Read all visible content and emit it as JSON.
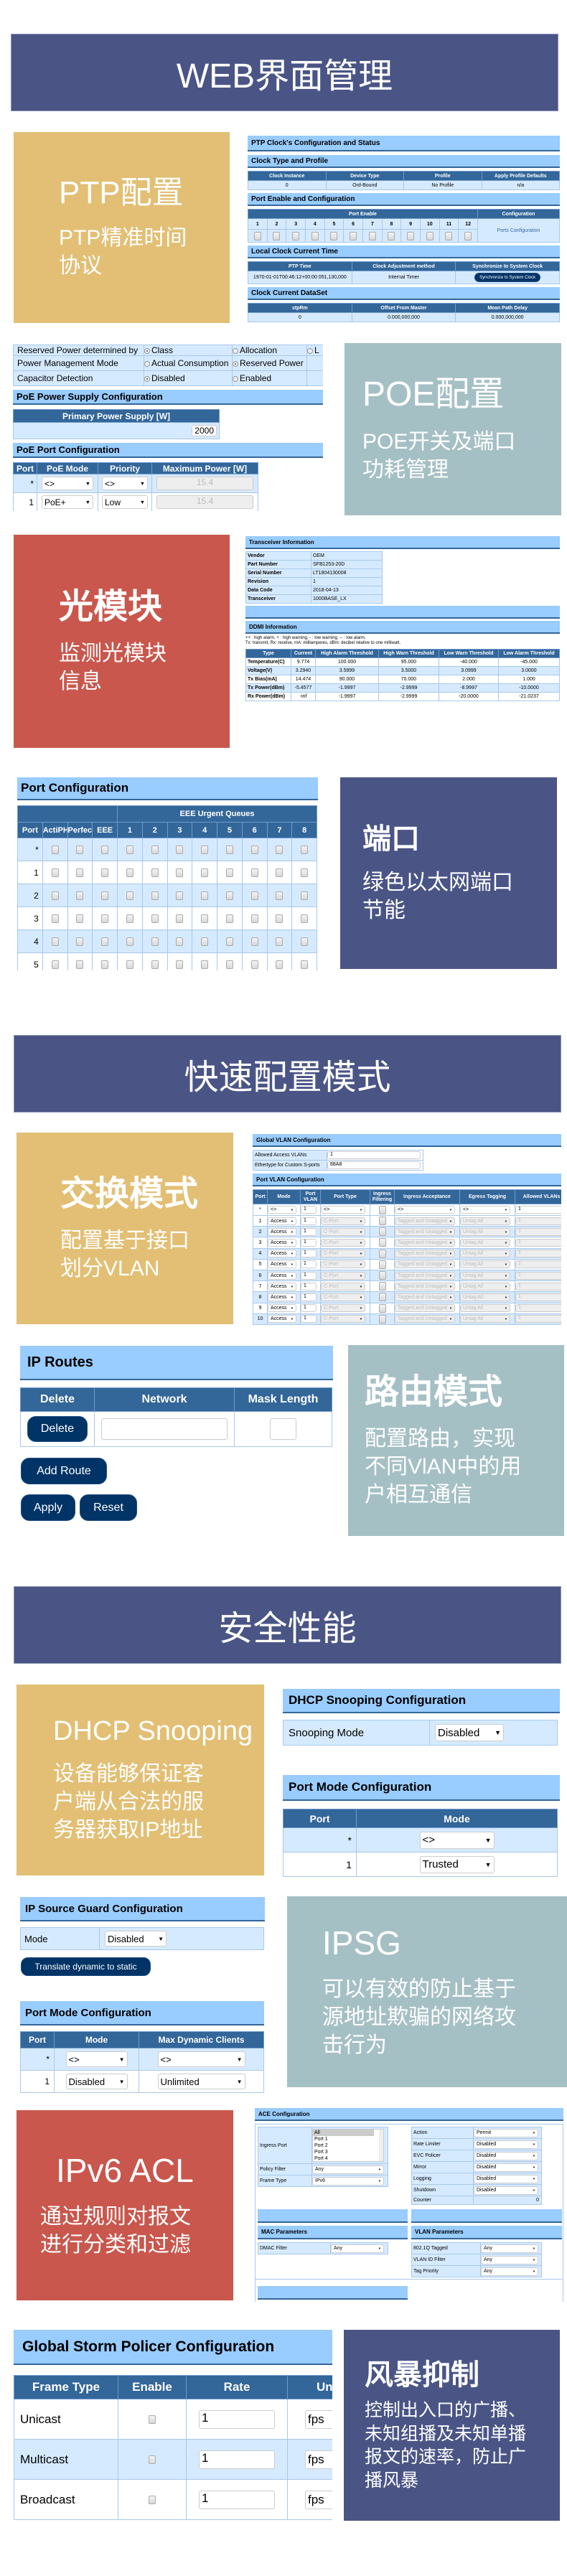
{
  "banners": [
    "WEB界面管理",
    "快速配置模式",
    "安全性能"
  ],
  "colors": {
    "banner": "#4a5586",
    "gold": "#e2bf74",
    "teal": "#a5c0c4",
    "red": "#c9574d",
    "header_bar": "#99ccff",
    "table_header": "#336699",
    "button": "#003366"
  },
  "features": {
    "ptp": {
      "title": "PTP配置",
      "desc": [
        "PTP精准时间",
        "协议"
      ]
    },
    "poe": {
      "title": "POE配置",
      "desc": [
        "POE开关及端口",
        "功耗管理"
      ]
    },
    "sfp": {
      "title": "光模块",
      "desc": [
        "监测光模块",
        "信息"
      ]
    },
    "port": {
      "title": "端口",
      "desc": [
        "绿色以太网端口",
        "节能"
      ]
    },
    "switch": {
      "title": "交换模式",
      "desc": [
        "配置基于接口",
        "划分VLAN"
      ]
    },
    "route": {
      "title": "路由模式",
      "desc": [
        "配置路由，实现",
        "不同VlAN中的用",
        "户相互通信"
      ]
    },
    "dhcp": {
      "title": "DHCP Snooping",
      "desc": [
        "设备能够保证客",
        "户端从合法的服",
        "务器获取IP地址"
      ]
    },
    "ipsg": {
      "title": "IPSG",
      "desc": [
        "可以有效的防止基于",
        "源地址欺骗的网络攻",
        "击行为"
      ]
    },
    "acl": {
      "title": "IPv6 ACL",
      "desc": [
        "通过规则对报文",
        "进行分类和过滤"
      ]
    },
    "storm": {
      "title": "风暴抑制",
      "desc": [
        "控制出入口的广播、",
        "未知组播及未知单播",
        "报文的速率，防止广",
        "播风暴"
      ]
    }
  },
  "screens": {
    "ptp": {
      "title": "PTP Clock's Configuration and Status",
      "clock_type": {
        "title": "Clock Type and Profile",
        "headers": [
          "Clock Instance",
          "Device Type",
          "Profile",
          "Apply Profile Defaults"
        ],
        "row": [
          "0",
          "Ord-Bound",
          "No Profile",
          "n/a"
        ]
      },
      "port_enable": {
        "title": "Port Enable and Configuration",
        "header_enable": "Port Enable",
        "header_config": "Configuration",
        "ports": [
          "1",
          "2",
          "3",
          "4",
          "5",
          "6",
          "7",
          "8",
          "9",
          "10",
          "11",
          "12"
        ],
        "config_link": "Ports Configuration"
      },
      "local_clock": {
        "title": "Local Clock Current Time",
        "headers": [
          "PTP Time",
          "Clock Adjustment method",
          "Synchronize to System Clock"
        ],
        "ptp_time": "1970-01-01T00:46:12+00:00 051,130,000",
        "method": "Internal Timer",
        "sync_button": "Synchronize to System Clock"
      },
      "dataset": {
        "title": "Clock Current DataSet",
        "headers": [
          "stpRm",
          "Offset From Master",
          "Mean Path Delay"
        ],
        "row": [
          "0",
          "0.000,000,000",
          "0.000,000,000"
        ]
      }
    },
    "poe": {
      "settings": [
        {
          "label": "Reserved Power determined by",
          "options": [
            "Class",
            "Allocation",
            "L"
          ],
          "selected": 0
        },
        {
          "label": "Power Management Mode",
          "options": [
            "Actual Consumption",
            "Reserved Power"
          ],
          "selected": 1
        },
        {
          "label": "Capacitor Detection",
          "options": [
            "Disabled",
            "Enabled"
          ],
          "selected": 0
        }
      ],
      "supply_title": "PoE Power Supply Configuration",
      "supply_header": "Primary Power Supply [W]",
      "supply_value": "2000",
      "port_title": "PoE Port Configuration",
      "headers": [
        "Port",
        "PoE Mode",
        "Priority",
        "Maximum Power [W]"
      ],
      "rows": [
        [
          "*",
          "<>",
          "<>",
          "15.4"
        ],
        [
          "1",
          "PoE+",
          "Low",
          "15.4"
        ]
      ]
    },
    "sfp": {
      "title": "Transceiver Information",
      "info": [
        [
          "Vendor",
          "OEM"
        ],
        [
          "Part Number",
          "SFB1253-20D"
        ],
        [
          "Serial Number",
          "LT1804130008"
        ],
        [
          "Revision",
          "1"
        ],
        [
          "Data Code",
          "2018-04-13"
        ],
        [
          "Transceiver",
          "1000BASE_LX"
        ]
      ],
      "ddmi_title": "DDMI Information",
      "legend": [
        "++ : high alarm, + : high warning, - : low warning, -- : low alarm.",
        "Tx: transmit, Rx: receive, mA: milliamperes, dBm: decibel relative to one milliwatt."
      ],
      "headers": [
        "Type",
        "Current",
        "High Alarm Threshold",
        "High Warn Threshold",
        "Low Warn Threshold",
        "Low Alarm Threshold"
      ],
      "rows": [
        [
          "Temperature(C)",
          "9.774",
          "100.000",
          "95.000",
          "-40.000",
          "-45.000"
        ],
        [
          "Voltage(V)",
          "3.2940",
          "3.5999",
          "3.5000",
          "3.0999",
          "3.0000"
        ],
        [
          "Tx Bias(mA)",
          "14.474",
          "90.000",
          "70.000",
          "2.000",
          "1.000"
        ],
        [
          "Tx Power(dBm)",
          "-5.4577",
          "-1.9997",
          "-2.9999",
          "-8.9997",
          "-10.0000"
        ],
        [
          "Rx Power(dBm)",
          "-inf",
          "-1.9997",
          "-2.9999",
          "-20.0000",
          "-21.0237"
        ]
      ]
    },
    "port_cfg": {
      "title": "Port Configuration",
      "group_header": "EEE Urgent Queues",
      "headers": [
        "Port",
        "ActiPHY",
        "PerfectReach",
        "EEE",
        "1",
        "2",
        "3",
        "4",
        "5",
        "6",
        "7",
        "8"
      ],
      "ports": [
        "*",
        "1",
        "2",
        "3",
        "4",
        "5"
      ]
    },
    "vlan": {
      "global_title": "Global VLAN Configuration",
      "fields": [
        [
          "Allowed Access VLANs",
          "1"
        ],
        [
          "Ethertype for Custom S-ports",
          "88A8"
        ]
      ],
      "port_title": "Port VLAN Configuration",
      "headers": [
        "Port",
        "Mode",
        "Port VLAN",
        "Port Type",
        "Ingress Filtering",
        "Ingress Acceptance",
        "Egress Tagging",
        "Allowed VLANs"
      ],
      "all_row": [
        "*",
        "<>",
        "1",
        "<>",
        "<>",
        "<>",
        "1"
      ],
      "rows": [
        [
          "1",
          "Access",
          "1",
          "C-Port",
          "Tagged and Untagged",
          "Untag All",
          "1"
        ],
        [
          "2",
          "Access",
          "1",
          "C-Port",
          "Tagged and Untagged",
          "Untag All",
          "1"
        ],
        [
          "3",
          "Access",
          "1",
          "C-Port",
          "Tagged and Untagged",
          "Untag All",
          "1"
        ],
        [
          "4",
          "Access",
          "1",
          "C-Port",
          "Tagged and Untagged",
          "Untag All",
          "1"
        ],
        [
          "5",
          "Access",
          "1",
          "C-Port",
          "Tagged and Untagged",
          "Untag All",
          "1"
        ],
        [
          "6",
          "Access",
          "1",
          "C-Port",
          "Tagged and Untagged",
          "Untag All",
          "1"
        ],
        [
          "7",
          "Access",
          "1",
          "C-Port",
          "Tagged and Untagged",
          "Untag All",
          "1"
        ],
        [
          "8",
          "Access",
          "1",
          "C-Port",
          "Tagged and Untagged",
          "Untag All",
          "1"
        ],
        [
          "9",
          "Access",
          "1",
          "C-Port",
          "Tagged and Untagged",
          "Untag All",
          "1"
        ],
        [
          "10",
          "Access",
          "1",
          "C-Port",
          "Tagged and Untagged",
          "Untag All",
          "1"
        ]
      ]
    },
    "routes": {
      "title": "IP Routes",
      "headers": [
        "Delete",
        "Network",
        "Mask Length"
      ],
      "delete_button": "Delete",
      "network_value": "",
      "mask_value": "",
      "add_button": "Add Route",
      "apply_button": "Apply",
      "reset_button": "Reset"
    },
    "dhcp": {
      "title": "DHCP Snooping Configuration",
      "mode_label": "Snooping Mode",
      "mode_value": "Disabled",
      "port_title": "Port Mode Configuration",
      "headers": [
        "Port",
        "Mode"
      ],
      "rows": [
        [
          "*",
          "<>"
        ],
        [
          "1",
          "Trusted"
        ]
      ]
    },
    "ipsg": {
      "title": "IP Source Guard Configuration",
      "mode_label": "Mode",
      "mode_value": "Disabled",
      "translate_button": "Translate dynamic to static",
      "port_title": "Port Mode Configuration",
      "headers": [
        "Port",
        "Mode",
        "Max Dynamic Clients"
      ],
      "rows": [
        [
          "*",
          "<>",
          "<>"
        ],
        [
          "1",
          "Disabled",
          "Unlimited"
        ]
      ]
    },
    "acl": {
      "title": "ACE Configuration",
      "ingress_label": "Ingress Port",
      "ingress_options": [
        "All",
        "Port 1",
        "Port 2",
        "Port 3",
        "Port 4"
      ],
      "left": [
        [
          "Policy Filter",
          "Any"
        ],
        [
          "Frame Type",
          "IPv6"
        ]
      ],
      "right": [
        [
          "Action",
          "Permit"
        ],
        [
          "Rate Limiter",
          "Disabled"
        ],
        [
          "EVC Policer",
          "Disabled"
        ],
        [
          "Mirror",
          "Disabled"
        ],
        [
          "Logging",
          "Disabled"
        ],
        [
          "Shutdown",
          "Disabled"
        ]
      ],
      "counter": [
        "Counter",
        "0"
      ],
      "mac_title": "MAC Parameters",
      "mac": [
        [
          "DMAC Filter",
          "Any"
        ]
      ],
      "vlan_title": "VLAN Parameters",
      "vlan": [
        [
          "802.1Q Tagged",
          "Any"
        ],
        [
          "VLAN ID Filter",
          "Any"
        ],
        [
          "Tag Priority",
          "Any"
        ]
      ]
    },
    "storm": {
      "title": "Global Storm Policer Configuration",
      "headers": [
        "Frame Type",
        "Enable",
        "Rate",
        "Un"
      ],
      "rows": [
        [
          "Unicast",
          "1",
          "fps"
        ],
        [
          "Multicast",
          "1",
          "fps"
        ],
        [
          "Broadcast",
          "1",
          "fps"
        ]
      ]
    }
  }
}
